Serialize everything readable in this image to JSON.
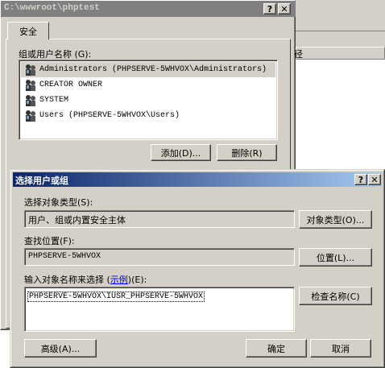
{
  "back_dialog": {
    "title": "C:\\wwwroot\\phptest",
    "help_btn": "?",
    "close_btn": "✕",
    "tab_security": "安全",
    "group_label": "组或用户名称 (G):",
    "users": [
      {
        "name": "Administrators (PHPSERVE-5WHVOX\\Administrators)"
      },
      {
        "name": "CREATOR OWNER"
      },
      {
        "name": "SYSTEM"
      },
      {
        "name": "Users (PHPSERVE-5WHVOX\\Users)"
      }
    ],
    "add_btn": "添加(D)...",
    "remove_btn": "删除(R)"
  },
  "right_window": {
    "column_header": "径"
  },
  "select_dialog": {
    "title": "选择用户或组",
    "help_btn": "?",
    "close_btn": "✕",
    "object_type_label": "选择对象类型(S):",
    "object_type_value": "用户、组或内置安全主体",
    "object_type_btn": "对象类型(O)...",
    "location_label": "查找位置(F):",
    "location_value": "PHPSERVE-5WHVOX",
    "location_btn": "位置(L)...",
    "enter_label_pre": "输入对象名称来选择 (",
    "enter_label_link": "示例",
    "enter_label_post": ")(E):",
    "object_name_value": "PHPSERVE-5WHVOX\\IUSR_PHPSERVE-5WHVOX",
    "check_names_btn": "检查名称(C)",
    "advanced_btn": "高级(A)...",
    "ok_btn": "确定",
    "cancel_btn": "取消"
  },
  "colors": {
    "face": "#d4d0c8",
    "active_title_start": "#0a246a",
    "active_title_end": "#a6caf0",
    "inactive_title": "#808080",
    "link": "#0000ff"
  }
}
